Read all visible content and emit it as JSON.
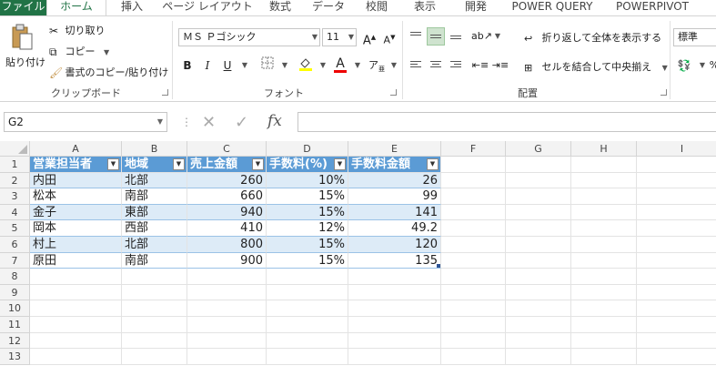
{
  "tabs": [
    "ファイル",
    "ホーム",
    "挿入",
    "ページ レイアウト",
    "数式",
    "データ",
    "校閲",
    "表示",
    "開発",
    "POWER QUERY",
    "POWERPIVOT"
  ],
  "clipboard": {
    "paste": "貼り付け",
    "cut": "切り取り",
    "copy": "コピー",
    "format_painter": "書式のコピー/貼り付け",
    "label": "クリップボード"
  },
  "font": {
    "name": "ＭＳ Ｐゴシック",
    "size": "11",
    "label": "フォント",
    "bold": "B",
    "italic": "I",
    "underline": "U"
  },
  "alignment": {
    "wrap_text": "折り返して全体を表示する",
    "merge_center": "セルを結合して中央揃え",
    "label": "配置"
  },
  "number": {
    "format": "標準"
  },
  "formula_bar": {
    "name_box": "G2",
    "fx": "fx",
    "value": ""
  },
  "columns": [
    "A",
    "B",
    "C",
    "D",
    "E",
    "F",
    "G",
    "H",
    "I"
  ],
  "rows": [
    "1",
    "2",
    "3",
    "4",
    "5",
    "6",
    "7",
    "8",
    "9",
    "10",
    "11",
    "12",
    "13"
  ],
  "table": {
    "headers": [
      "営業担当者",
      "地域",
      "売上金額",
      "手数料(%)",
      "手数料金額"
    ],
    "rows": [
      [
        "内田",
        "北部",
        "260",
        "10%",
        "26"
      ],
      [
        "松本",
        "南部",
        "660",
        "15%",
        "99"
      ],
      [
        "金子",
        "東部",
        "940",
        "15%",
        "141"
      ],
      [
        "岡本",
        "西部",
        "410",
        "12%",
        "49.2"
      ],
      [
        "村上",
        "北部",
        "800",
        "15%",
        "120"
      ],
      [
        "原田",
        "南部",
        "900",
        "15%",
        "135"
      ]
    ]
  },
  "colors": {
    "excel_green": "#217346",
    "table_header": "#5b9bd5",
    "table_band": "#ddebf7"
  }
}
